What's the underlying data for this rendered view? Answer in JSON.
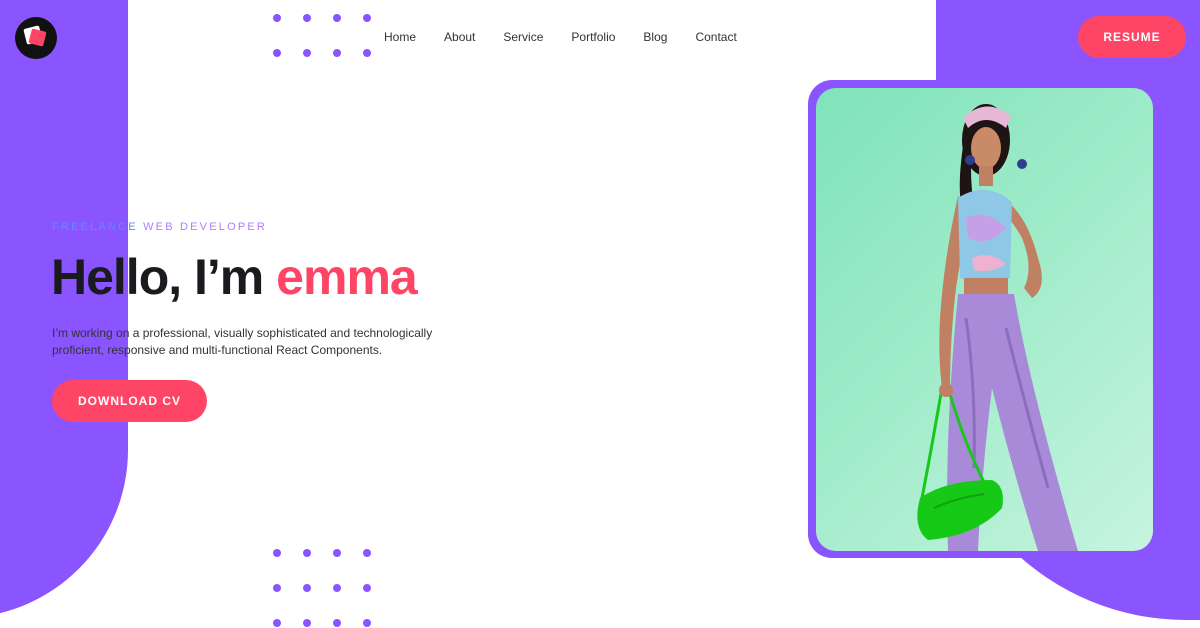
{
  "nav": {
    "items": [
      {
        "label": "Home"
      },
      {
        "label": "About"
      },
      {
        "label": "Service"
      },
      {
        "label": "Portfolio"
      },
      {
        "label": "Blog"
      },
      {
        "label": "Contact"
      }
    ],
    "resume_label": "RESUME"
  },
  "hero": {
    "subtitle_first": "FREELANCE",
    "subtitle_rest": "WEB DEVELOPER",
    "greeting": "Hello, I’m",
    "name": "emma",
    "description": "I’m working on a professional, visually sophisticated and technologically proficient, responsive and multi-functional React Components.",
    "download_label": "DOWNLOAD CV"
  },
  "colors": {
    "accent_purple": "#8a54ff",
    "accent_pink": "#ff4566",
    "text_dark": "#1b1b1f"
  },
  "icons": {
    "logo": "logo-icon"
  }
}
